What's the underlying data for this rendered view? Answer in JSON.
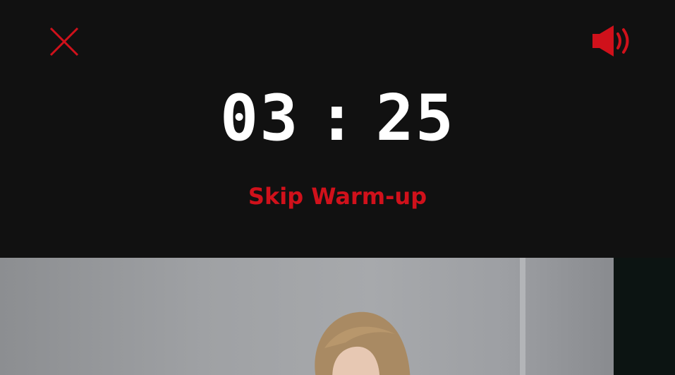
{
  "toolbar": {
    "close_icon": "close-icon",
    "sound_icon": "volume-icon"
  },
  "timer": {
    "minutes": "03",
    "separator": ":",
    "seconds": "25"
  },
  "actions": {
    "skip_label": "Skip Warm-up"
  },
  "colors": {
    "background": "#111111",
    "accent": "#d0111b",
    "timer_text": "#ffffff"
  }
}
